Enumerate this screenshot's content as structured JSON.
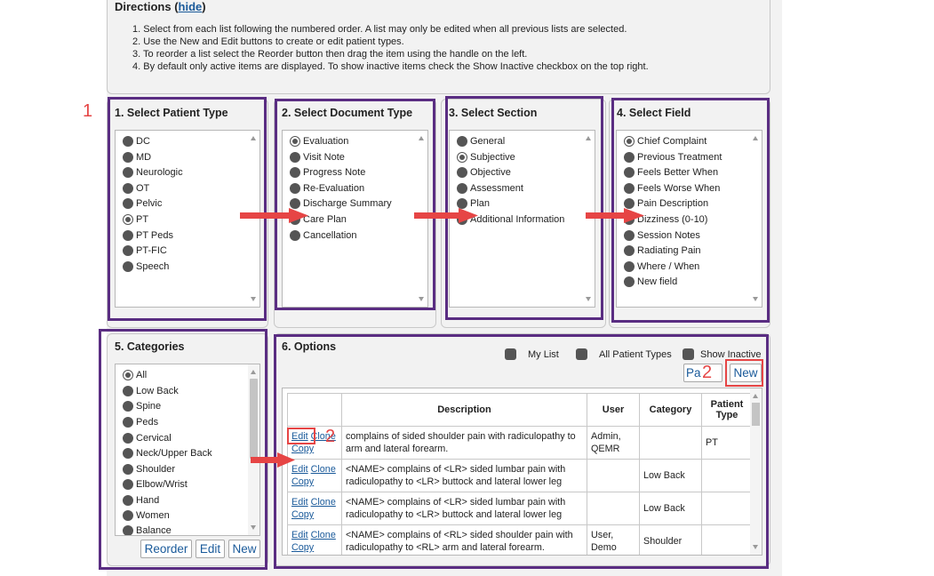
{
  "directions": {
    "title": "Directions",
    "hide_link": "hide",
    "steps": [
      "1. Select from each list following the numbered order. A list may only be edited when all previous lists are selected.",
      "2. Use the New and Edit buttons to create or edit patient types.",
      "3. To reorder a list select the Reorder button then drag the item using the handle on the left.",
      "4. By default only active items are displayed. To show inactive items check the Show Inactive checkbox on the top right."
    ]
  },
  "annotations": {
    "marker_1": "1",
    "marker_2a": "2",
    "marker_2b": "2",
    "color": "#e64545",
    "frame_color": "#5a2d82"
  },
  "patient_type": {
    "title": "1. Select Patient Type",
    "items": [
      "DC",
      "MD",
      "Neurologic",
      "OT",
      "Pelvic",
      "PT",
      "PT Peds",
      "PT-FIC",
      "Speech"
    ],
    "selected": "PT"
  },
  "document_type": {
    "title": "2. Select Document Type",
    "items": [
      "Evaluation",
      "Visit Note",
      "Progress Note",
      "Re-Evaluation",
      "Discharge Summary",
      "Care Plan",
      "Cancellation"
    ],
    "selected": "Evaluation"
  },
  "section": {
    "title": "3. Select Section",
    "items": [
      "General",
      "Subjective",
      "Objective",
      "Assessment",
      "Plan",
      "Additional Information"
    ],
    "selected": "Subjective"
  },
  "field": {
    "title": "4. Select Field",
    "items": [
      "Chief Complaint",
      "Previous Treatment",
      "Feels Better When",
      "Feels Worse When",
      "Pain Description",
      "Dizziness (0-10)",
      "Session Notes",
      "Radiating Pain",
      "Where / When",
      "New field"
    ],
    "selected": "Chief Complaint"
  },
  "categories": {
    "title": "5. Categories",
    "items": [
      "All",
      "Low Back",
      "Spine",
      "Peds",
      "Cervical",
      "Neck/Upper Back",
      "Shoulder",
      "Elbow/Wrist",
      "Hand",
      "Women",
      "Balance"
    ],
    "selected": "All",
    "buttons": {
      "reorder": "Reorder",
      "edit": "Edit",
      "new": "New"
    }
  },
  "options": {
    "title": "6. Options",
    "checkboxes": {
      "my_list": "My List",
      "all_patient_types": "All Patient Types",
      "show_inactive": "Show Inactive"
    },
    "paste_button": "Pa",
    "new_button": "New",
    "columns": [
      "",
      "Description",
      "User",
      "Category",
      "Patient Type"
    ],
    "row_actions": {
      "edit": "Edit",
      "clone": "Clone",
      "copy": "Copy"
    },
    "rows": [
      {
        "description": "complains of sided shoulder pain with radiculopathy to arm and lateral forearm.",
        "user": "Admin, QEMR",
        "category": "",
        "patient_type": "PT"
      },
      {
        "description": "<NAME> complains of <LR> sided lumbar pain with radiculopathy to <LR> buttock and lateral lower leg",
        "user": "",
        "category": "Low Back",
        "patient_type": ""
      },
      {
        "description": "<NAME> complains of <LR> sided lumbar pain with radiculopathy to <LR> buttock and lateral lower leg",
        "user": "",
        "category": "Low Back",
        "patient_type": ""
      },
      {
        "description": "<NAME> complains of <RL> sided shoulder pain with radiculopathy to <RL> arm and lateral forearm.",
        "user": "User, Demo",
        "category": "Shoulder",
        "patient_type": ""
      }
    ]
  }
}
